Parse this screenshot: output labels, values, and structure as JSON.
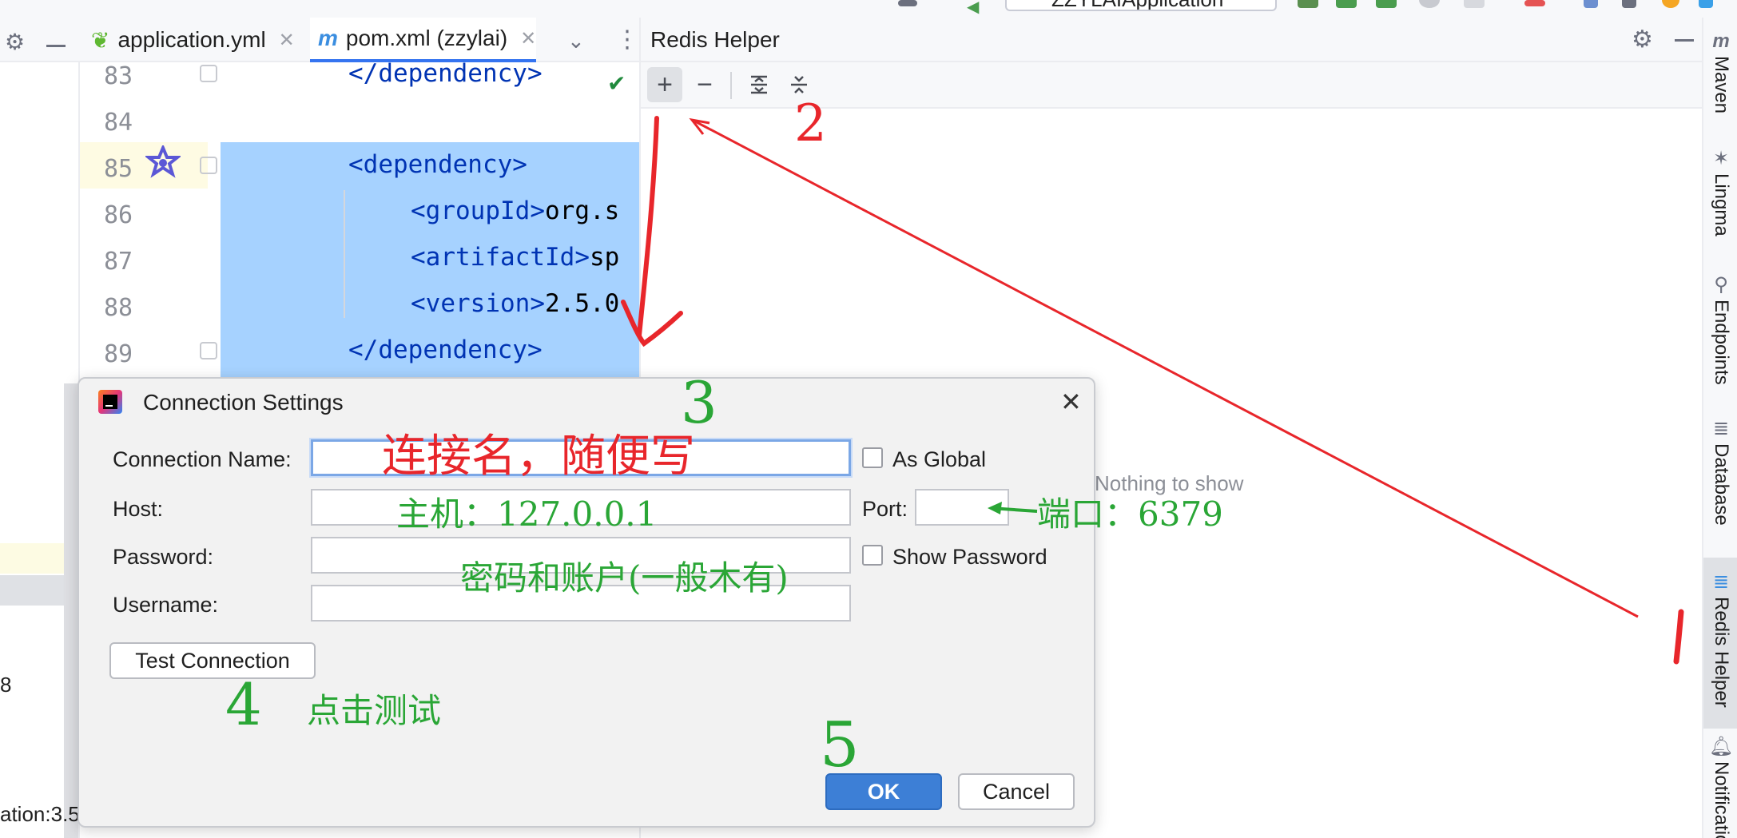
{
  "toolbar": {
    "run_config_label": "ZZYLAIApplication"
  },
  "editor_tabs": [
    {
      "label": "application.yml",
      "icon": "spring-leaf-icon"
    },
    {
      "label": "pom.xml (zzylai)",
      "icon": "maven-m-icon"
    }
  ],
  "editor": {
    "line_numbers": [
      "83",
      "84",
      "85",
      "86",
      "87",
      "88",
      "89"
    ],
    "lines": {
      "l83": "</dependency>",
      "l85": "<dependency>",
      "l86_tag": "groupId",
      "l86_text": "org.s",
      "l87_tag": "artifactId",
      "l87_text": "sp",
      "l88_tag": "version",
      "l88_text": "2.5.0",
      "l89": "</dependency>"
    }
  },
  "left_panel": {
    "fragment_1": "8",
    "fragment_2": "ation:3.5"
  },
  "redis_helper": {
    "title": "Redis Helper",
    "empty_text": "Nothing to show",
    "toolbar_buttons": [
      "+",
      "−"
    ]
  },
  "right_stripe": [
    {
      "label": "Maven",
      "icon": "maven-icon"
    },
    {
      "label": "Lingma",
      "icon": "lingma-icon"
    },
    {
      "label": "Endpoints",
      "icon": "endpoints-icon"
    },
    {
      "label": "Database",
      "icon": "database-icon"
    },
    {
      "label": "Redis Helper",
      "icon": "redis-icon"
    },
    {
      "label": "Notifications",
      "icon": "bell-icon"
    }
  ],
  "dialog": {
    "title": "Connection Settings",
    "fields": {
      "connection_name_label": "Connection Name:",
      "connection_name_value": "",
      "host_label": "Host:",
      "host_value": "",
      "port_label": "Port:",
      "port_value": "",
      "password_label": "Password:",
      "password_value": "",
      "username_label": "Username:",
      "username_value": ""
    },
    "as_global_label": "As Global",
    "as_global_checked": false,
    "show_password_label": "Show Password",
    "show_password_checked": false,
    "test_button": "Test Connection",
    "ok_button": "OK",
    "cancel_button": "Cancel"
  },
  "annotations": {
    "step1": "1",
    "step2": "2",
    "step3": "3",
    "step4": "4",
    "step5": "5",
    "connection_name_note": "连接名，随便写",
    "host_note": "主机：127.0.0.1",
    "port_note": "端口：6379",
    "credentials_note": "密码和账户(一般木有)",
    "test_note": "点击测试"
  },
  "colors": {
    "accent": "#3574f0",
    "selection": "#a6d2ff",
    "annotation_red": "#e8262b",
    "annotation_green": "#2aa636",
    "xml_tag": "#0033b3"
  }
}
